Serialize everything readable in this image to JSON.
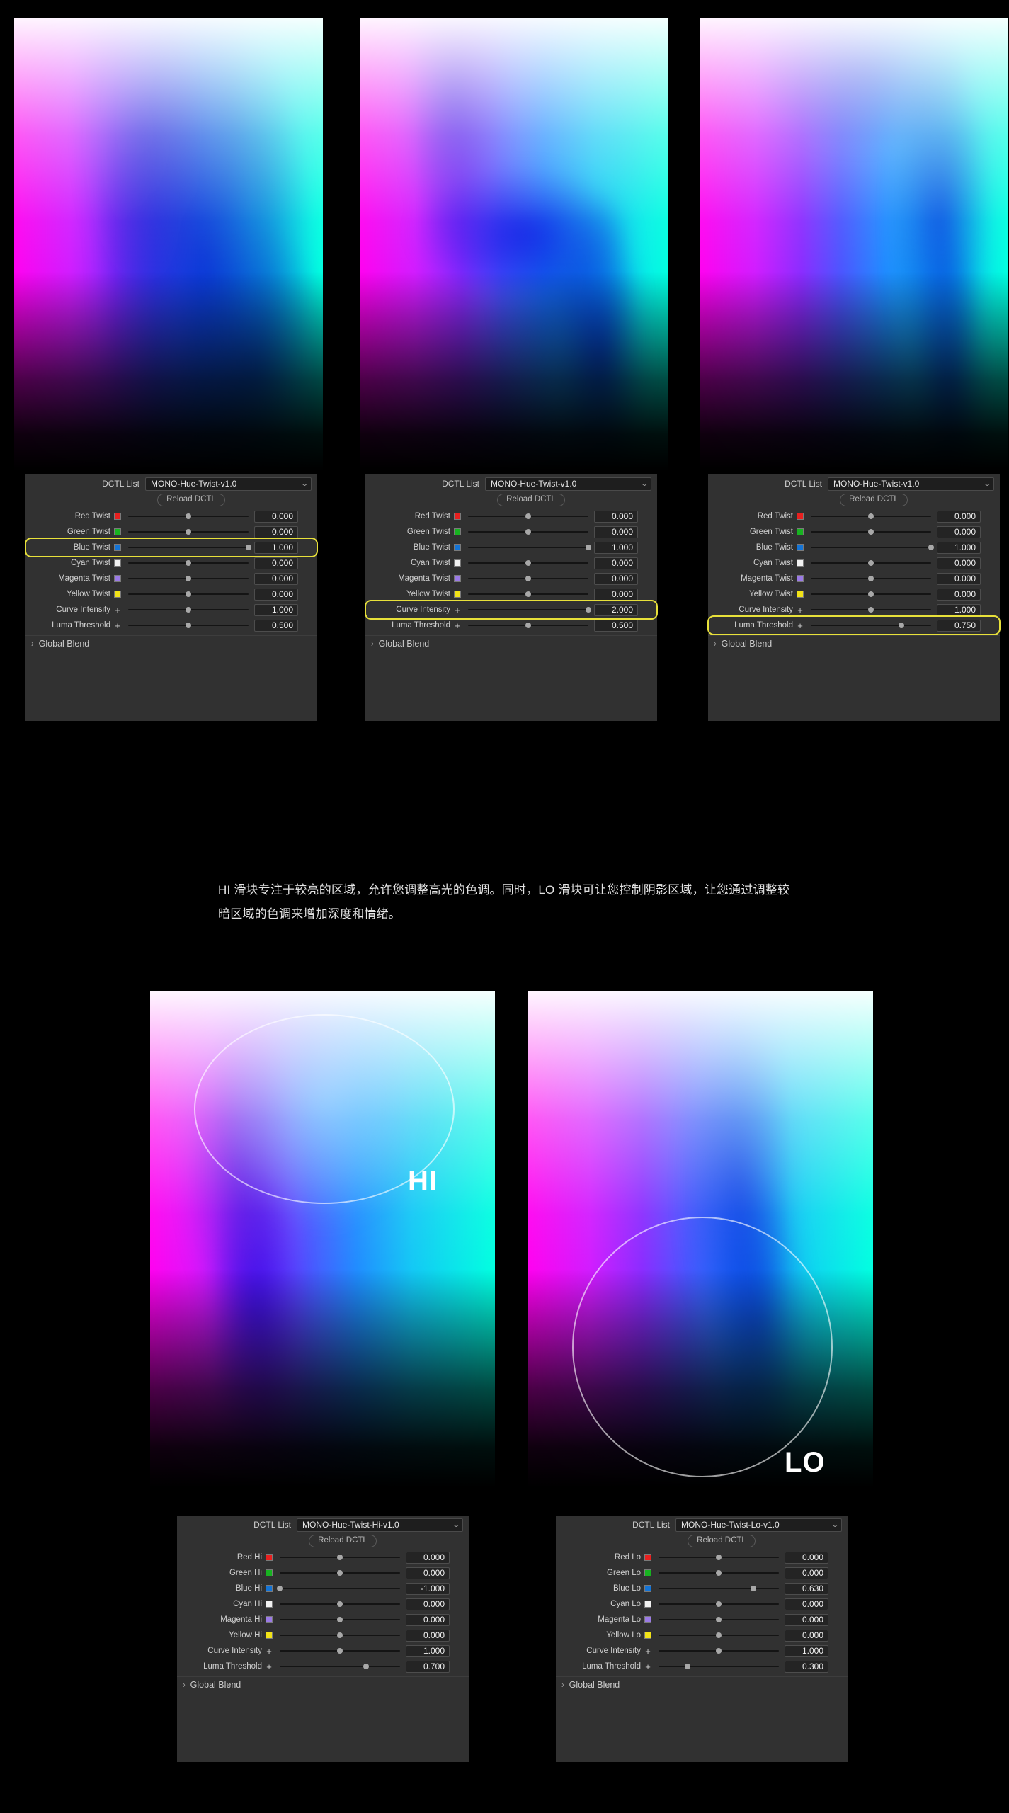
{
  "caption": {
    "text": "HI 滑块专注于较亮的区域，允许您调整高光的色调。同时，LO 滑块可让您控制阴影区域，让您通过调整较暗区域的色调来增加深度和情绪。"
  },
  "common": {
    "dctl_list_label": "DCTL List",
    "reload_label": "Reload DCTL",
    "global_blend_label": "Global Blend",
    "chevron_down": "⌄",
    "chevron_right": "›",
    "plus": "+"
  },
  "swatch_colors": {
    "red": "#e8201f",
    "green": "#17b320",
    "blue": "#1474d6",
    "cyan": "#f2f2f2",
    "magenta": "#9b7ae6",
    "yellow": "#f2e317"
  },
  "highlight_color": "#e8e13a",
  "panels": [
    {
      "id": "panel-1",
      "dctl_value": "MONO-Hue-Twist-v1.0",
      "highlight_row": 2,
      "rows": [
        {
          "label": "Red Twist",
          "swatch": "red",
          "value": "0.000",
          "pos": 0.5
        },
        {
          "label": "Green Twist",
          "swatch": "green",
          "value": "0.000",
          "pos": 0.5
        },
        {
          "label": "Blue Twist",
          "swatch": "blue",
          "value": "1.000",
          "pos": 1.0
        },
        {
          "label": "Cyan Twist",
          "swatch": "cyan",
          "value": "0.000",
          "pos": 0.5
        },
        {
          "label": "Magenta Twist",
          "swatch": "magenta",
          "value": "0.000",
          "pos": 0.5
        },
        {
          "label": "Yellow Twist",
          "swatch": "yellow",
          "value": "0.000",
          "pos": 0.5
        },
        {
          "label": "Curve Intensity",
          "swatch": "plus",
          "value": "1.000",
          "pos": 0.5
        },
        {
          "label": "Luma Threshold",
          "swatch": "plus",
          "value": "0.500",
          "pos": 0.5
        }
      ]
    },
    {
      "id": "panel-2",
      "dctl_value": "MONO-Hue-Twist-v1.0",
      "highlight_row": 6,
      "rows": [
        {
          "label": "Red Twist",
          "swatch": "red",
          "value": "0.000",
          "pos": 0.5
        },
        {
          "label": "Green Twist",
          "swatch": "green",
          "value": "0.000",
          "pos": 0.5
        },
        {
          "label": "Blue Twist",
          "swatch": "blue",
          "value": "1.000",
          "pos": 1.0
        },
        {
          "label": "Cyan Twist",
          "swatch": "cyan",
          "value": "0.000",
          "pos": 0.5
        },
        {
          "label": "Magenta Twist",
          "swatch": "magenta",
          "value": "0.000",
          "pos": 0.5
        },
        {
          "label": "Yellow Twist",
          "swatch": "yellow",
          "value": "0.000",
          "pos": 0.5
        },
        {
          "label": "Curve Intensity",
          "swatch": "plus",
          "value": "2.000",
          "pos": 1.0
        },
        {
          "label": "Luma Threshold",
          "swatch": "plus",
          "value": "0.500",
          "pos": 0.5
        }
      ]
    },
    {
      "id": "panel-3",
      "dctl_value": "MONO-Hue-Twist-v1.0",
      "highlight_row": 7,
      "rows": [
        {
          "label": "Red Twist",
          "swatch": "red",
          "value": "0.000",
          "pos": 0.5
        },
        {
          "label": "Green Twist",
          "swatch": "green",
          "value": "0.000",
          "pos": 0.5
        },
        {
          "label": "Blue Twist",
          "swatch": "blue",
          "value": "1.000",
          "pos": 1.0
        },
        {
          "label": "Cyan Twist",
          "swatch": "cyan",
          "value": "0.000",
          "pos": 0.5
        },
        {
          "label": "Magenta Twist",
          "swatch": "magenta",
          "value": "0.000",
          "pos": 0.5
        },
        {
          "label": "Yellow Twist",
          "swatch": "yellow",
          "value": "0.000",
          "pos": 0.5
        },
        {
          "label": "Curve Intensity",
          "swatch": "plus",
          "value": "1.000",
          "pos": 0.5
        },
        {
          "label": "Luma Threshold",
          "swatch": "plus",
          "value": "0.750",
          "pos": 0.75
        }
      ]
    },
    {
      "id": "panel-hi",
      "dctl_value": "MONO-Hue-Twist-Hi-v1.0",
      "highlight_row": -1,
      "rows": [
        {
          "label": "Red Hi",
          "swatch": "red",
          "value": "0.000",
          "pos": 0.5
        },
        {
          "label": "Green Hi",
          "swatch": "green",
          "value": "0.000",
          "pos": 0.5
        },
        {
          "label": "Blue Hi",
          "swatch": "blue",
          "value": "-1.000",
          "pos": 0.0
        },
        {
          "label": "Cyan Hi",
          "swatch": "cyan",
          "value": "0.000",
          "pos": 0.5
        },
        {
          "label": "Magenta Hi",
          "swatch": "magenta",
          "value": "0.000",
          "pos": 0.5
        },
        {
          "label": "Yellow Hi",
          "swatch": "yellow",
          "value": "0.000",
          "pos": 0.5
        },
        {
          "label": "Curve Intensity",
          "swatch": "plus",
          "value": "1.000",
          "pos": 0.5
        },
        {
          "label": "Luma Threshold",
          "swatch": "plus",
          "value": "0.700",
          "pos": 0.72
        }
      ]
    },
    {
      "id": "panel-lo",
      "dctl_value": "MONO-Hue-Twist-Lo-v1.0",
      "highlight_row": -1,
      "rows": [
        {
          "label": "Red Lo",
          "swatch": "red",
          "value": "0.000",
          "pos": 0.5
        },
        {
          "label": "Green Lo",
          "swatch": "green",
          "value": "0.000",
          "pos": 0.5
        },
        {
          "label": "Blue Lo",
          "swatch": "blue",
          "value": "0.630",
          "pos": 0.79
        },
        {
          "label": "Cyan Lo",
          "swatch": "cyan",
          "value": "0.000",
          "pos": 0.5
        },
        {
          "label": "Magenta Lo",
          "swatch": "magenta",
          "value": "0.000",
          "pos": 0.5
        },
        {
          "label": "Yellow Lo",
          "swatch": "yellow",
          "value": "0.000",
          "pos": 0.5
        },
        {
          "label": "Curve Intensity",
          "swatch": "plus",
          "value": "1.000",
          "pos": 0.5
        },
        {
          "label": "Luma Threshold",
          "swatch": "plus",
          "value": "0.300",
          "pos": 0.24
        }
      ]
    }
  ],
  "previews": [
    {
      "id": "preview-1",
      "twist": "twist-a",
      "label": ""
    },
    {
      "id": "preview-2",
      "twist": "twist-b",
      "label": ""
    },
    {
      "id": "preview-3",
      "twist": "twist-c",
      "label": ""
    },
    {
      "id": "preview-hi",
      "twist": "twist-hi",
      "label": "HI"
    },
    {
      "id": "preview-lo",
      "twist": "twist-lo",
      "label": "LO"
    }
  ]
}
